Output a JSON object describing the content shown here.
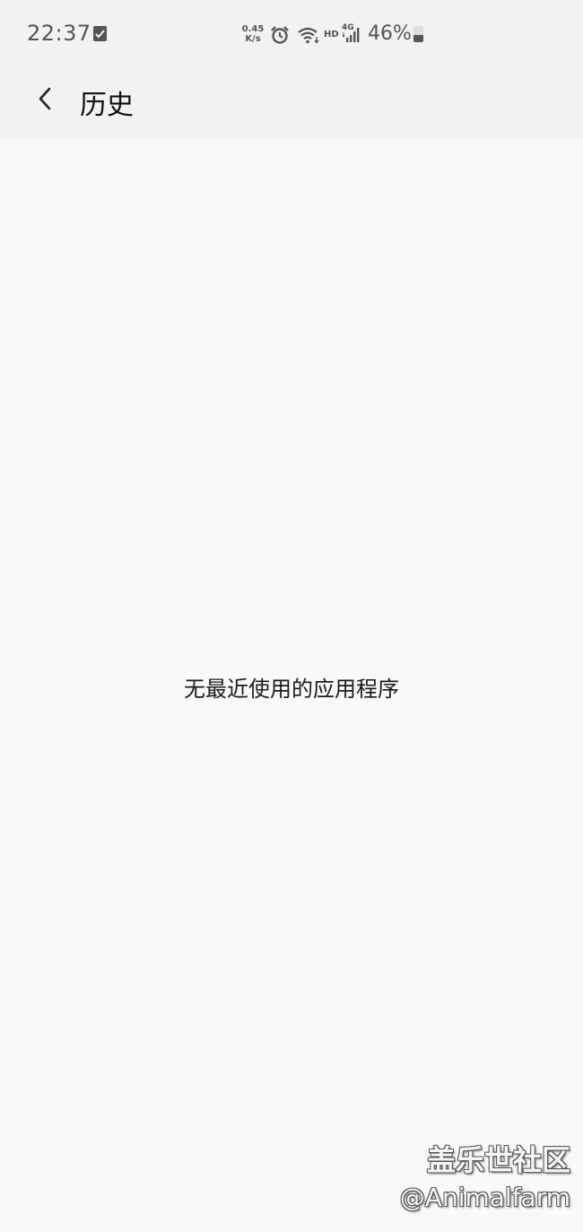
{
  "status_bar": {
    "time": "22:37",
    "net_speed_value": "0.45",
    "net_speed_unit": "K/s",
    "hd_label": "HD",
    "network_label": "4G",
    "battery_percent": "46%",
    "battery_level": 0.46,
    "icons": [
      "checkbox-notification-icon",
      "alarm-icon",
      "wifi-icon",
      "signal-icon",
      "battery-icon"
    ]
  },
  "app_bar": {
    "title": "历史",
    "back_icon": "chevron-left-icon"
  },
  "empty_state": {
    "message": "无最近使用的应用程序"
  },
  "watermark": {
    "brand": "盖乐世社区",
    "user": "@Animalfarm"
  }
}
